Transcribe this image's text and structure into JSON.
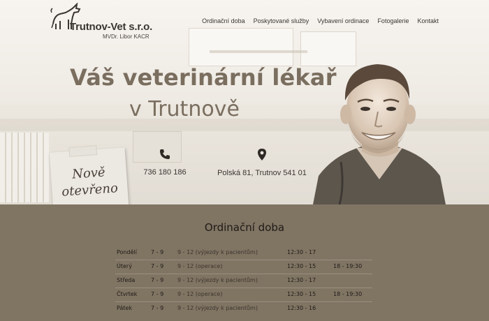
{
  "logo": {
    "name": "Trutnov-Vet s.r.o.",
    "subtitle": "MVDr. Libor KACR"
  },
  "nav": {
    "items": [
      "Ordinační doba",
      "Poskytované služby",
      "Vybavení ordinace",
      "Fotogalerie",
      "Kontakt"
    ]
  },
  "hero": {
    "headline_line1": "Váš veterinární lékař",
    "headline_line2": "v Trutnově",
    "phone": "736 180 186",
    "address": "Polská 81, Trutnov 541 01",
    "note_line1": "Nově",
    "note_line2": "otevřeno"
  },
  "hours": {
    "title": "Ordinační doba",
    "rows": [
      [
        "Pondělí",
        "7 - 9",
        "9 - 12 (výjezdy k pacientům)",
        "12:30 - 17",
        ""
      ],
      [
        "Úterý",
        "7 - 9",
        "9 - 12 (operace)",
        "12:30 - 15",
        "18 - 19:30"
      ],
      [
        "Středa",
        "7 - 9",
        "9 - 12 (výjezdy k pacientům)",
        "12:30 - 17",
        ""
      ],
      [
        "Čtvrtek",
        "7 - 9",
        "9 - 12 (operace)",
        "12:30 - 15",
        "18 - 19:30"
      ],
      [
        "Pátek",
        "7 - 9",
        "9 - 12 (výjezdy k pacientům)",
        "12:30 - 16",
        ""
      ]
    ]
  },
  "colors": {
    "brown_band": "#807463",
    "headline": "#7a6e5f",
    "text_dark": "#3a3530"
  }
}
